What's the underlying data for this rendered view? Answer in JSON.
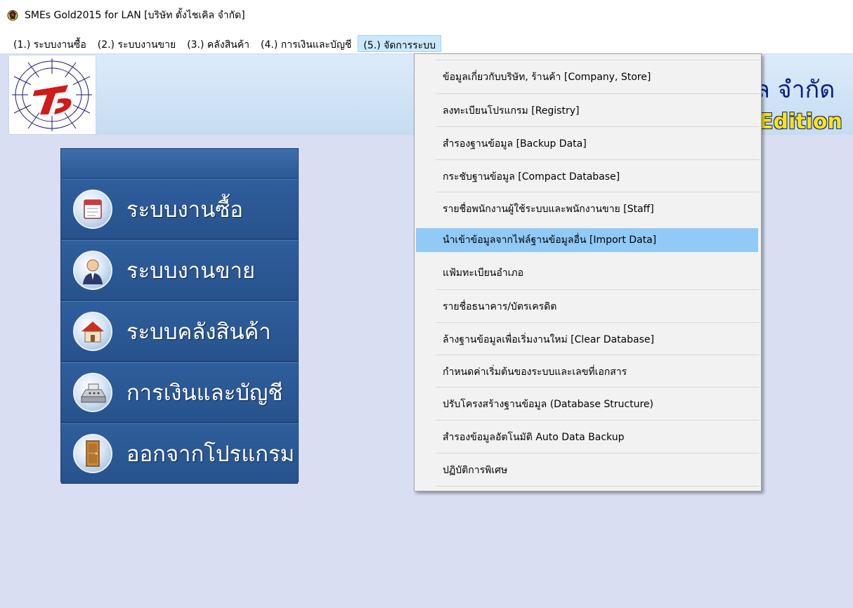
{
  "window": {
    "title": "SMEs Gold2015 for LAN [บริษัท ตั้งไชเคิล จำกัด]"
  },
  "menubar": {
    "items": [
      {
        "label": "(1.) ระบบงานซื้อ"
      },
      {
        "label": "(2.) ระบบงานขาย"
      },
      {
        "label": "(3.) คลังสินค้า"
      },
      {
        "label": "(4.) การเงินและบัญชี"
      },
      {
        "label": "(5.) จัดการระบบ"
      }
    ],
    "active_index": 4
  },
  "banner": {
    "company_partial": "ัล จำกัด",
    "edition_partial": "Edition",
    "logo_text": "TS"
  },
  "nav": {
    "items": [
      {
        "label": "ระบบงานซื้อ",
        "icon": "calendar-icon"
      },
      {
        "label": "ระบบงานขาย",
        "icon": "salesman-icon"
      },
      {
        "label": "ระบบคลังสินค้า",
        "icon": "house-icon"
      },
      {
        "label": "การเงินและบัญชี",
        "icon": "cash-register-icon"
      },
      {
        "label": "ออกจากโปรแกรม",
        "icon": "door-icon"
      }
    ]
  },
  "dropdown": {
    "items": [
      {
        "label": "ข้อมูลเกี่ยวกับบริษัท, ร้านค้า [Company, Store]"
      },
      {
        "label": "ลงทะเบียนโปรแกรม [Registry]"
      },
      {
        "label": "สำรองฐานข้อมูล [Backup Data]"
      },
      {
        "label": "กระชับฐานข้อมูล [Compact Database]"
      },
      {
        "label": "รายชื่อพนักงานผู้ใช้ระบบและพนักงานขาย [Staff]"
      },
      {
        "label": "นำเข้าข้อมูลจากไฟล์ฐานข้อมูลอื่น [Import Data]"
      },
      {
        "label": "แฟ้มทะเบียนอำเภอ"
      },
      {
        "label": "รายชื่อธนาคาร/บัตรเครดิต"
      },
      {
        "label": "ล้างฐานข้อมูลเพื่อเริ่มงานใหม่ [Clear Database]"
      },
      {
        "label": "กำหนดค่าเริ่มต้นของระบบและเลขที่เอกสาร"
      },
      {
        "label": "ปรับโครงสร้างฐานข้อมูล (Database Structure)"
      },
      {
        "label": "สำรองข้อมูลอัตโนมัติ Auto Data Backup"
      },
      {
        "label": "ปฏิบัติการพิเศษ"
      }
    ],
    "highlight_index": 5
  },
  "colors": {
    "accent": "#91c9f7",
    "nav_bg": "#2a5590",
    "banner_title": "#0a1f8f",
    "edition": "#ffe600"
  }
}
